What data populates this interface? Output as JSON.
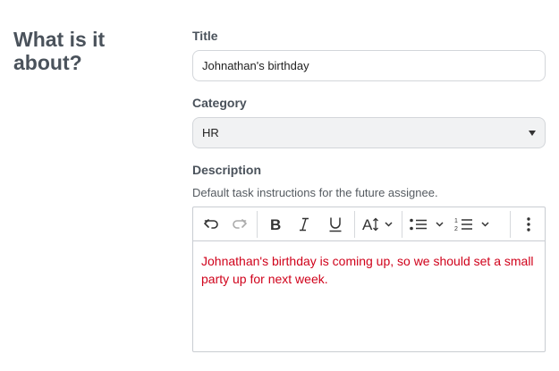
{
  "section": {
    "heading": "What is it about?"
  },
  "title_field": {
    "label": "Title",
    "value": "Johnathan's birthday"
  },
  "category_field": {
    "label": "Category",
    "selected": "HR"
  },
  "description_field": {
    "label": "Description",
    "helper": "Default task instructions for the future assignee.",
    "content": "Johnathan's birthday is coming up, so we should set a small party up for next week.",
    "content_color": "#d0021b"
  },
  "toolbar": {
    "buttons": [
      "undo-icon",
      "redo-icon",
      "bold-icon",
      "italic-icon",
      "underline-icon",
      "font-size-icon",
      "bulleted-list-icon",
      "numbered-list-icon",
      "more-options-icon"
    ]
  }
}
